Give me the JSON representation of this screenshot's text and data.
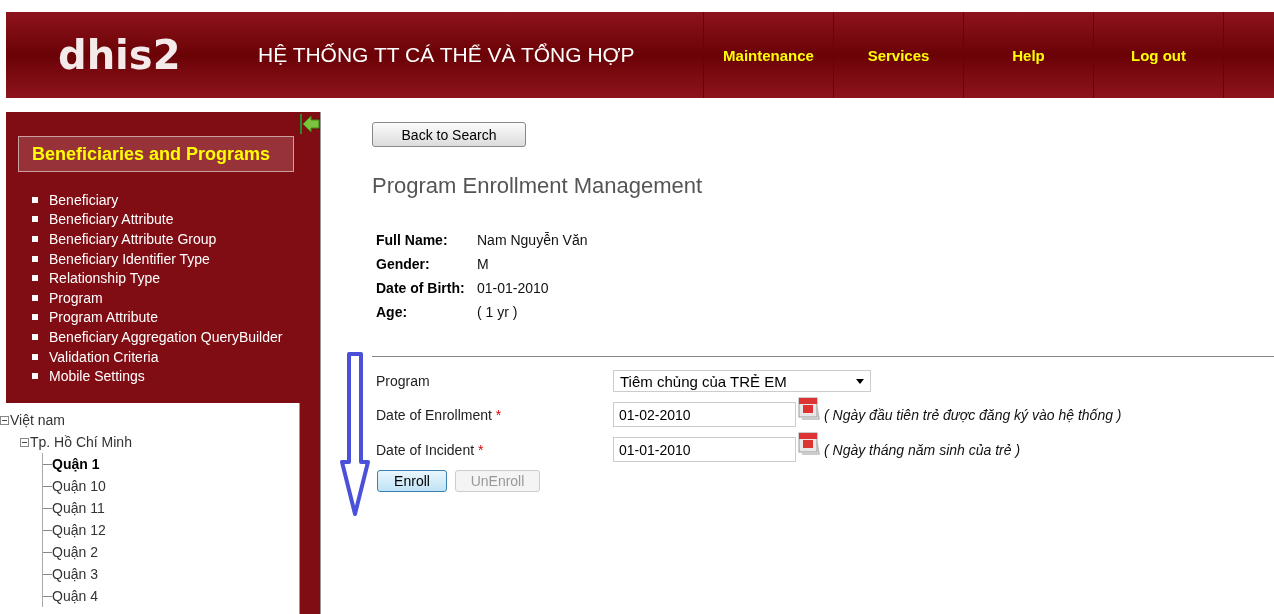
{
  "header": {
    "logo": "dhis2",
    "title": "HỆ THỐNG TT CÁ THỂ VÀ TỔNG HỢP",
    "menu": [
      "Maintenance",
      "Services",
      "Help",
      "Log out"
    ]
  },
  "sidebar": {
    "heading": "Beneficiaries and Programs",
    "items": [
      "Beneficiary",
      "Beneficiary Attribute",
      "Beneficiary Attribute Group",
      "Beneficiary Identifier Type",
      "Relationship Type",
      "Program",
      "Program Attribute",
      "Beneficiary Aggregation QueryBuilder",
      "Validation Criteria",
      "Mobile Settings"
    ]
  },
  "tree": [
    {
      "label": "Việt nam",
      "expanded": true,
      "selected": false,
      "children": [
        {
          "label": "Tp. Hồ Chí Minh",
          "expanded": true,
          "selected": false,
          "children": [
            {
              "label": "Quận 1",
              "selected": true
            },
            {
              "label": "Quận 10",
              "selected": false
            },
            {
              "label": "Quận 11",
              "selected": false
            },
            {
              "label": "Quận 12",
              "selected": false
            },
            {
              "label": "Quận 2",
              "selected": false
            },
            {
              "label": "Quận 3",
              "selected": false
            },
            {
              "label": "Quận 4",
              "selected": false
            }
          ]
        }
      ]
    }
  ],
  "back_button": "Back to Search",
  "page_title": "Program Enrollment Management",
  "details": [
    {
      "label": "Full Name:",
      "value": "Nam Nguyễn Văn"
    },
    {
      "label": "Gender:",
      "value": "M"
    },
    {
      "label": "Date of Birth:",
      "value": "01-01-2010"
    },
    {
      "label": "Age:",
      "value": "( 1 yr )"
    }
  ],
  "form": [
    {
      "kind": "select",
      "label": "Program",
      "required": false,
      "value": "Tiêm chủng của TRẺ EM"
    },
    {
      "kind": "date",
      "label": "Date of Enrollment",
      "required": true,
      "value": "01-02-2010",
      "hint": "( Ngày đầu tiên trẻ được đăng ký vào hệ thống )"
    },
    {
      "kind": "date",
      "label": "Date of Incident",
      "required": true,
      "value": "01-01-2010",
      "hint": "( Ngày tháng năm sinh của trẻ )"
    }
  ],
  "required_mark": "*",
  "buttons": [
    {
      "label": "Enroll",
      "disabled": false
    },
    {
      "label": "UnEnroll",
      "disabled": true
    }
  ]
}
